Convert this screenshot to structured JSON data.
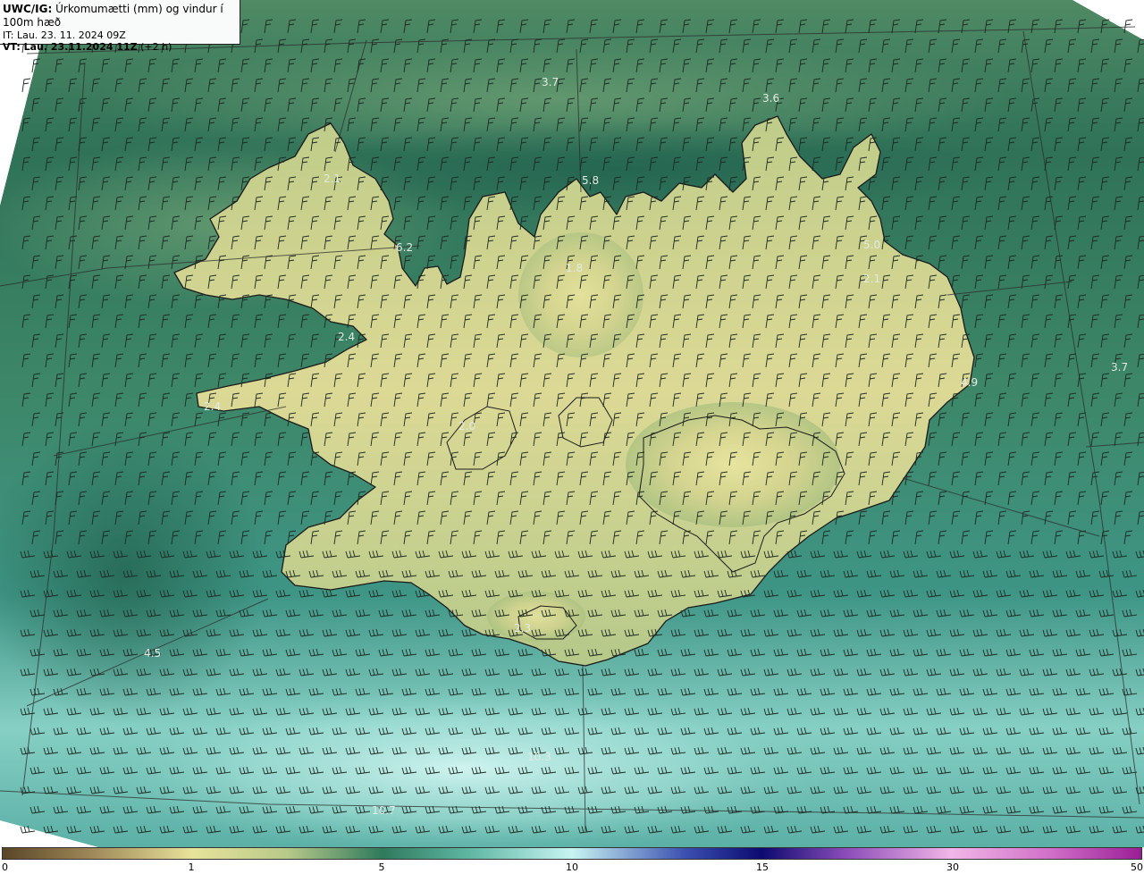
{
  "header": {
    "product": "UWC/IG:",
    "variable": "Úrkomumætti (mm) og vindur í 100m hæð",
    "it_line": "IT: Lau. 23. 11. 2024 09Z",
    "vt_prefix": "VT: ",
    "vt_bold": "Lau. 23.11.2024 11Z",
    "vt_suffix": " (+2 h)"
  },
  "map": {
    "region": "Iceland",
    "field": "precipitable water",
    "overlay": "wind barbs at 100 m",
    "value_labels": [
      {
        "id": "label-1",
        "text": "3.7"
      },
      {
        "id": "label-2",
        "text": "3.6"
      },
      {
        "id": "label-3",
        "text": "5.8"
      },
      {
        "id": "label-4",
        "text": "2.1"
      },
      {
        "id": "label-5",
        "text": "6.2"
      },
      {
        "id": "label-6",
        "text": "5.0"
      },
      {
        "id": "label-7",
        "text": "1.8"
      },
      {
        "id": "label-8",
        "text": "2.1"
      },
      {
        "id": "label-9",
        "text": "2.4"
      },
      {
        "id": "label-10",
        "text": "3.7"
      },
      {
        "id": "label-11",
        "text": "4.9"
      },
      {
        "id": "label-12",
        "text": "2.4"
      },
      {
        "id": "label-13",
        "text": "2.0"
      },
      {
        "id": "label-14",
        "text": "4.5"
      },
      {
        "id": "label-15",
        "text": "2.3"
      },
      {
        "id": "label-16",
        "text": "10.3"
      },
      {
        "id": "label-17",
        "text": "10.7"
      }
    ]
  },
  "colorbar": {
    "ticks": [
      "0",
      "1",
      "5",
      "10",
      "15",
      "30",
      "50"
    ],
    "stops": [
      {
        "value": "0",
        "color": "#5a4628"
      },
      {
        "value": "1",
        "color": "#e8e39a"
      },
      {
        "value": "5",
        "color": "#2f7a5d"
      },
      {
        "value": "10",
        "color": "#c8f4f2"
      },
      {
        "value": "15",
        "color": "#0c0a70"
      },
      {
        "value": "30",
        "color": "#f2b6e8"
      },
      {
        "value": "50",
        "color": "#9a1e96"
      }
    ]
  },
  "colors": {
    "sea_dark": "#2f7258",
    "land_yellow": "#e3dd97",
    "south_cyan": "#bdece6"
  }
}
